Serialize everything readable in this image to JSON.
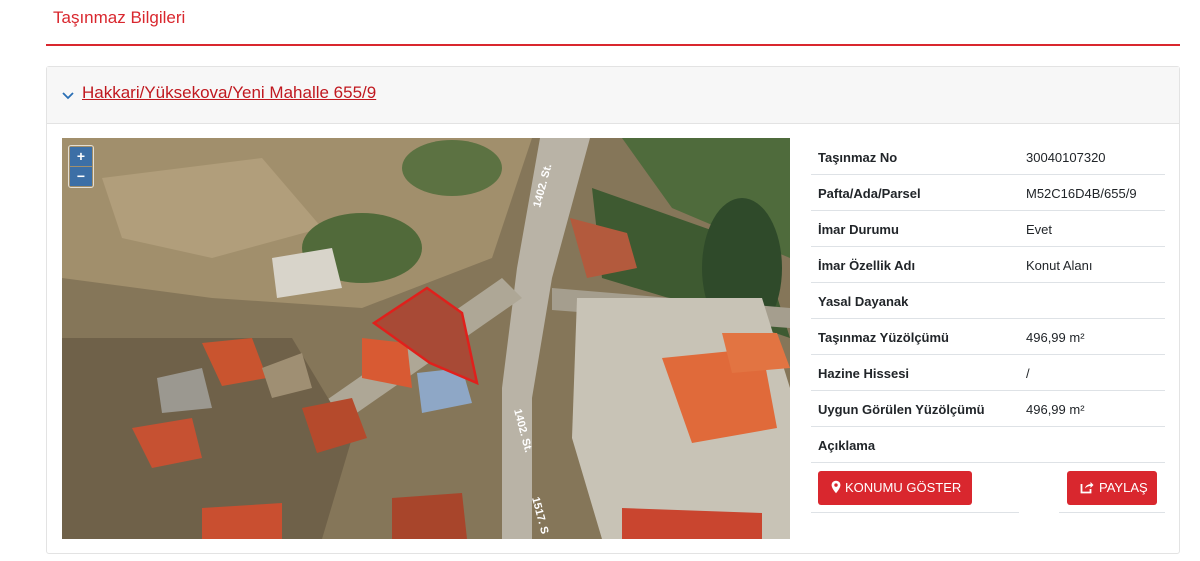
{
  "page": {
    "title": "Taşınmaz Bilgileri"
  },
  "parcel": {
    "title": "Hakkari/Yüksekova/Yeni Mahalle 655/9"
  },
  "map": {
    "zoom_in": "+",
    "zoom_out": "−",
    "street_labels": [
      "1402. St.",
      "1402. St.",
      "1517. S"
    ]
  },
  "details": [
    {
      "key": "Taşınmaz No",
      "value": "30040107320"
    },
    {
      "key": "Pafta/Ada/Parsel",
      "value": "M52C16D4B/655/9"
    },
    {
      "key": "İmar Durumu",
      "value": "Evet"
    },
    {
      "key": "İmar Özellik Adı",
      "value": "Konut Alanı"
    },
    {
      "key": "Yasal Dayanak",
      "value": ""
    },
    {
      "key": "Taşınmaz Yüzölçümü",
      "value": "496,99 m²"
    },
    {
      "key": "Hazine Hissesi",
      "value": "/"
    },
    {
      "key": "Uygun Görülen Yüzölçümü",
      "value": "496,99 m²"
    },
    {
      "key": "Açıklama",
      "value": ""
    }
  ],
  "actions": {
    "show_location": "KONUMU GÖSTER",
    "share": "PAYLAŞ"
  },
  "colors": {
    "accent": "#d9272e",
    "link": "#c0181f",
    "parcel_outline": "#e0201c"
  },
  "icons": {
    "expand": "chevron-down-icon",
    "location": "map-marker-icon",
    "share": "share-icon"
  }
}
